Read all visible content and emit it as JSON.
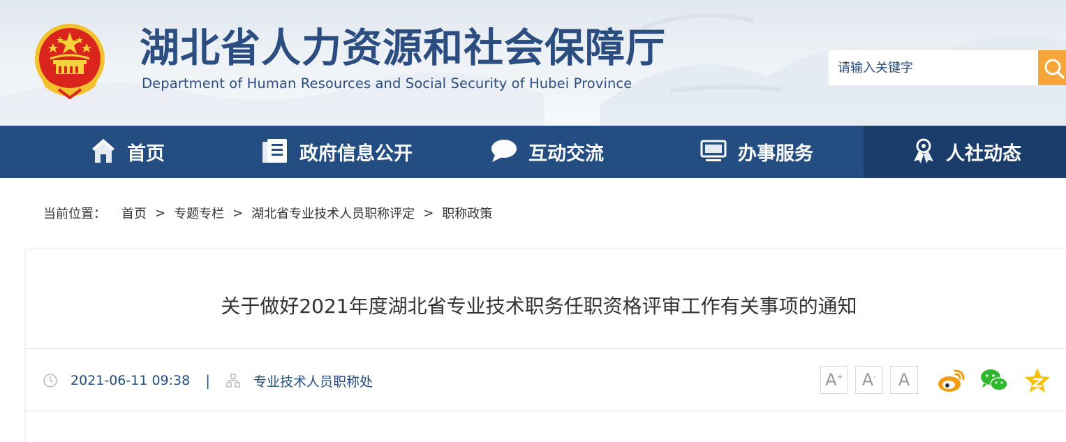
{
  "header": {
    "title": "湖北省人力资源和社会保障厅",
    "subtitle": "Department of Human Resources and Social Security of Hubei Province",
    "search_placeholder": "请输入关键字"
  },
  "nav": {
    "items": [
      {
        "label": "首页",
        "icon": "home-icon"
      },
      {
        "label": "政府信息公开",
        "icon": "document-icon"
      },
      {
        "label": "互动交流",
        "icon": "chat-bubble-icon"
      },
      {
        "label": "办事服务",
        "icon": "monitor-icon"
      },
      {
        "label": "人社动态",
        "icon": "person-award-icon",
        "active": true
      }
    ]
  },
  "breadcrumb": {
    "prefix": "当前位置：",
    "items": [
      "首页",
      "专题专栏",
      "湖北省专业技术人员职称评定",
      "职称政策"
    ],
    "separator": ">"
  },
  "article": {
    "title": "关于做好2021年度湖北省专业技术职务任职资格评审工作有关事项的通知",
    "date": "2021-06-11 09:38",
    "separator": "|",
    "source": "专业技术人员职称处",
    "font_buttons": [
      "A",
      "A",
      "A"
    ],
    "font_button_marks": [
      "+",
      "-",
      ""
    ],
    "share_icons": [
      "weibo-icon",
      "wechat-icon",
      "qzone-icon"
    ]
  },
  "colors": {
    "nav_bg": "#244d82",
    "nav_active_bg": "#1a3d6b",
    "title_blue": "#2b4d80",
    "search_button": "#f5a53a",
    "weibo_orange": "#f39c12",
    "wechat_green": "#2eb82e",
    "qzone_yellow": "#f5c000"
  }
}
